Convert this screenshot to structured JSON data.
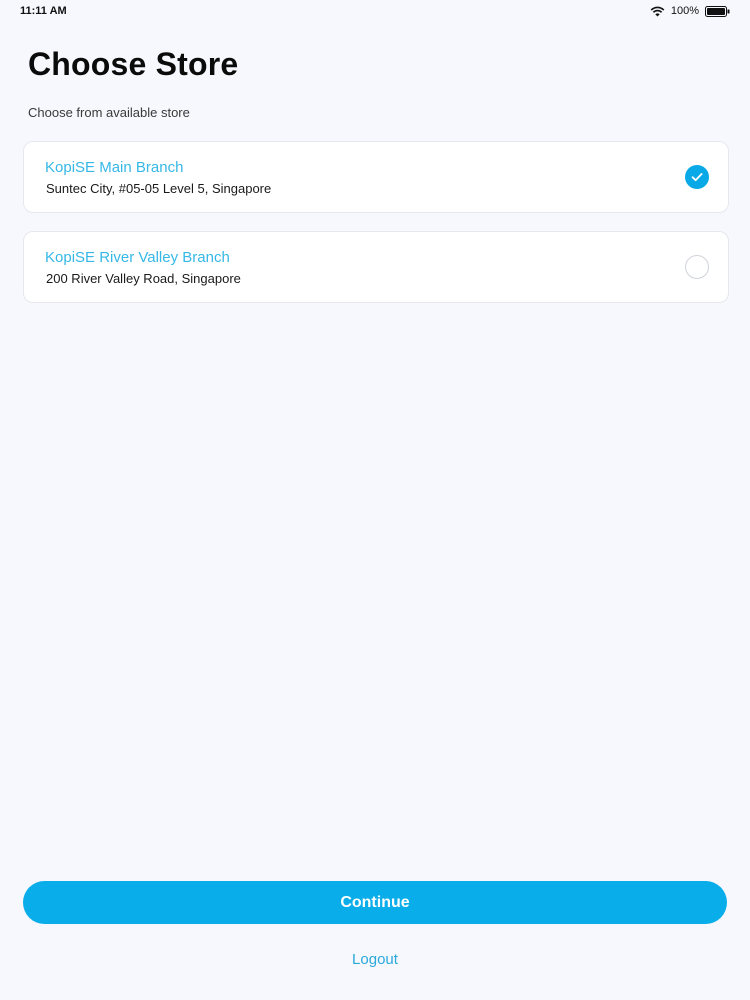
{
  "status_bar": {
    "time": "11:11 AM",
    "battery_percent": "100%",
    "battery_level": 1.0,
    "wifi_icon": "wifi-icon",
    "battery_icon": "battery-icon"
  },
  "header": {
    "title": "Choose Store",
    "subtitle": "Choose from available store"
  },
  "stores": [
    {
      "name": "KopiSE Main Branch",
      "address": "Suntec City, #05-05 Level 5, Singapore",
      "selected": true
    },
    {
      "name": "KopiSE River Valley Branch",
      "address": "200 River Valley Road, Singapore",
      "selected": false
    }
  ],
  "actions": {
    "continue_label": "Continue",
    "logout_label": "Logout"
  },
  "colors": {
    "accent": "#08ade9",
    "store_name": "#36b8e6",
    "background": "#f7f8fd"
  }
}
